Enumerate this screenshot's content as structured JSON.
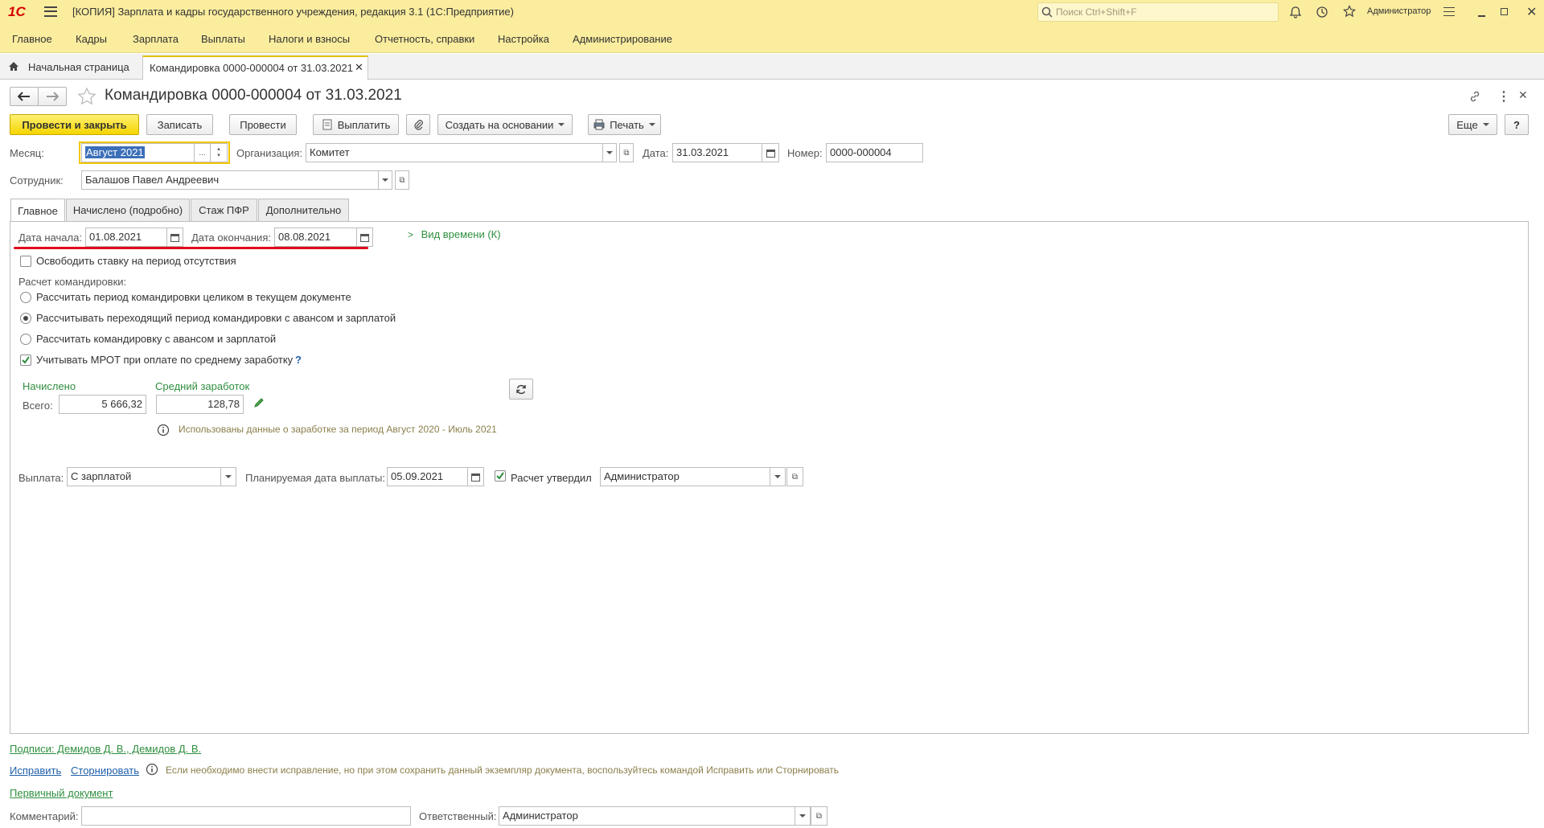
{
  "titlebar": {
    "app_logo": "1С",
    "title": "[КОПИЯ] Зарплата и кадры государственного учреждения, редакция 3.1  (1С:Предприятие)",
    "search_placeholder": "Поиск Ctrl+Shift+F",
    "user": "Администратор"
  },
  "menu": [
    "Главное",
    "Кадры",
    "Зарплата",
    "Выплаты",
    "Налоги и взносы",
    "Отчетность, справки",
    "Настройка",
    "Администрирование"
  ],
  "tabs_strip": {
    "home": "Начальная страница",
    "open_doc": "Командировка 0000-000004 от 31.03.2021"
  },
  "document": {
    "title": "Командировка 0000-000004 от 31.03.2021"
  },
  "toolbar": {
    "post_close": "Провести и закрыть",
    "save": "Записать",
    "post": "Провести",
    "pay": "Выплатить",
    "create_based": "Создать на основании",
    "print": "Печать",
    "more": "Еще",
    "help": "?"
  },
  "header_fields": {
    "month_label": "Месяц:",
    "month_value": "Август 2021",
    "org_label": "Организация:",
    "org_value": "Комитет",
    "date_label": "Дата:",
    "date_value": "31.03.2021",
    "number_label": "Номер:",
    "number_value": "0000-000004",
    "employee_label": "Сотрудник:",
    "employee_value": "Балашов Павел Андреевич"
  },
  "form_tabs": [
    "Главное",
    "Начислено (подробно)",
    "Стаж ПФР",
    "Дополнительно"
  ],
  "main_tab": {
    "start_label": "Дата начала:",
    "start_value": "01.08.2021",
    "end_label": "Дата окончания:",
    "end_value": "08.08.2021",
    "time_type": "Вид времени (К)",
    "free_rate": "Освободить ставку на период отсутствия",
    "calc_title": "Расчет командировки:",
    "radio1": "Рассчитать период командировки целиком в текущем документе",
    "radio2": "Рассчитывать переходящий период командировки с авансом и зарплатой",
    "radio3": "Рассчитать командировку с авансом и зарплатой",
    "mrot": "Учитывать МРОТ при оплате по среднему заработку",
    "mrot_help": "?",
    "accrued_header": "Начислено",
    "avg_header": "Средний заработок",
    "total_label": "Всего:",
    "total_value": "5 666,32",
    "avg_value": "128,78",
    "info": "Использованы данные о заработке за период Август 2020 - Июль 2021",
    "payout_label": "Выплата:",
    "payout_value": "С зарплатой",
    "plan_date_label": "Планируемая дата выплаты:",
    "plan_date_value": "05.09.2021",
    "approved_label": "Расчет утвердил",
    "approved_value": "Администратор"
  },
  "footer": {
    "signatures": "Подписи: Демидов Д. В., Демидов Д. В.",
    "fix": "Исправить",
    "reverse": "Сторнировать",
    "fix_info": "Если необходимо внести исправление, но при этом сохранить данный экземпляр документа, воспользуйтесь командой Исправить или Сторнировать",
    "primary_doc": "Первичный документ",
    "comment_label": "Комментарий:",
    "comment_value": "",
    "responsible_label": "Ответственный:",
    "responsible_value": "Администратор"
  },
  "colors": {
    "accent_yellow": "#fbed9e",
    "primary_button": "#f5d500",
    "link_green": "#2f8f3f",
    "highlight_red": "#e0001a"
  }
}
